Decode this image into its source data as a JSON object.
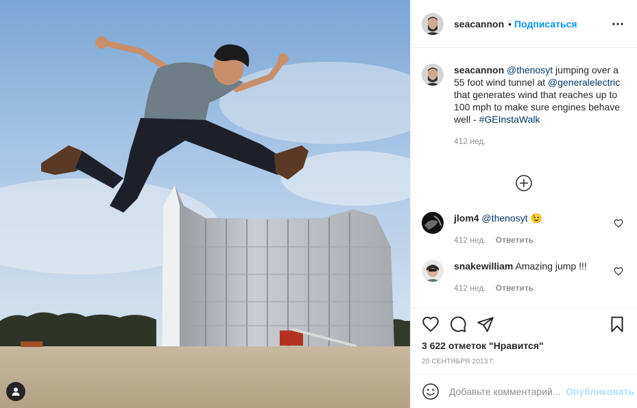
{
  "post": {
    "author": "seacannon",
    "follow_label": "Подписаться",
    "separator": "•",
    "more_icon": "more-horizontal-icon",
    "tag_icon": "user-tag-icon"
  },
  "caption": {
    "username": "seacannon",
    "mention": "@thenosyt",
    "text_1": " jumping over a 55 foot wind tunnel at ",
    "mention_2": "@generalelectric",
    "text_2": " that generates wind that reaches up to 100 mph to make sure engines behave well - ",
    "hashtag": "#GEInstaWalk",
    "time": "412 нед."
  },
  "load_more_icon": "plus-circle-icon",
  "comments": [
    {
      "username": "jlom4",
      "mention": "@thenosyt",
      "text": "",
      "emoji": "😉",
      "time": "412 нед.",
      "reply_label": "Ответить"
    },
    {
      "username": "snakewilliam",
      "mention": "",
      "text": "Amazing jump !!!",
      "emoji": "",
      "time": "412 нед.",
      "reply_label": "Ответить"
    }
  ],
  "actions": {
    "like_icon": "heart-icon",
    "comment_icon": "comment-icon",
    "share_icon": "paper-plane-icon",
    "save_icon": "bookmark-icon",
    "likes": "3 622 отметок \"Нравится\"",
    "date": "20 сентября 2013 г."
  },
  "add_comment": {
    "emoji_icon": "smiley-icon",
    "placeholder": "Добавьте комментарий...",
    "post_label": "Опубликовать"
  },
  "colors": {
    "link_blue": "#0095f6",
    "mention": "#00376b",
    "muted": "#8e8e8e",
    "post_disabled": "#b2dffc"
  }
}
